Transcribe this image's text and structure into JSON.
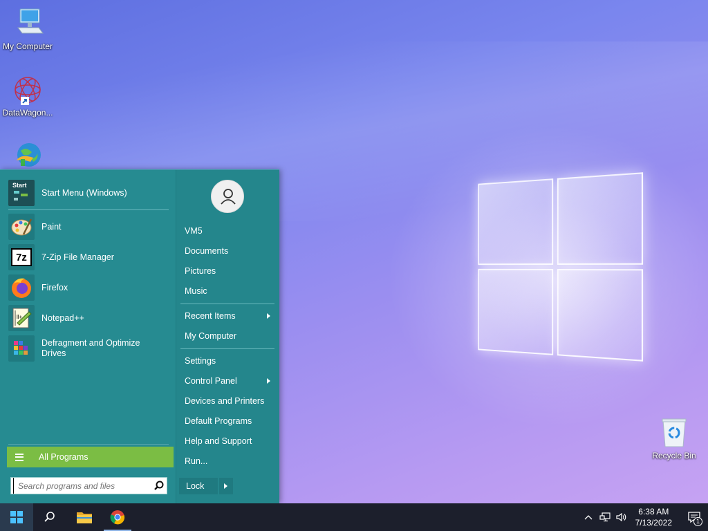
{
  "desktop": {
    "icons": [
      {
        "label": "My Computer",
        "icon": "computer-icon"
      },
      {
        "label": "DataWagon...",
        "icon": "datawagon-icon"
      },
      {
        "label": "",
        "icon": "internet-download-icon"
      },
      {
        "label": "Recycle Bin",
        "icon": "recycle-bin-icon"
      }
    ]
  },
  "start_menu": {
    "pinned": {
      "label": "Start Menu (Windows)",
      "icon_text": "Start",
      "icon": "start-menu-app-icon"
    },
    "recent_programs": [
      {
        "label": "Paint",
        "icon": "paint-icon"
      },
      {
        "label": "7-Zip File Manager",
        "icon": "7zip-icon",
        "icon_text": "7z"
      },
      {
        "label": "Firefox",
        "icon": "firefox-icon"
      },
      {
        "label": "Notepad++",
        "icon": "notepadpp-icon"
      },
      {
        "label": "Defragment and Optimize Drives",
        "icon": "defrag-icon"
      }
    ],
    "all_programs_label": "All Programs",
    "search_placeholder": "Search programs and files",
    "user_links": [
      "VM5",
      "Documents",
      "Pictures",
      "Music"
    ],
    "recent_links": [
      {
        "label": "Recent Items",
        "submenu": true
      },
      {
        "label": "My Computer",
        "submenu": false
      }
    ],
    "system_links": [
      {
        "label": "Settings",
        "submenu": false
      },
      {
        "label": "Control Panel",
        "submenu": true
      },
      {
        "label": "Devices and Printers",
        "submenu": false
      },
      {
        "label": "Default Programs",
        "submenu": false
      },
      {
        "label": "Help and Support",
        "submenu": false
      },
      {
        "label": "Run...",
        "submenu": false
      }
    ],
    "lock_label": "Lock"
  },
  "taskbar": {
    "apps": [
      "windows-start-icon",
      "search-icon",
      "file-explorer-icon",
      "chrome-icon"
    ],
    "clock_time": "6:38 AM",
    "clock_date": "7/13/2022",
    "notification_count": "1"
  },
  "colors": {
    "menu_bg": "#268b91",
    "all_programs_bg": "#7bbd44",
    "taskbar_bg": "#1c1f2c"
  }
}
